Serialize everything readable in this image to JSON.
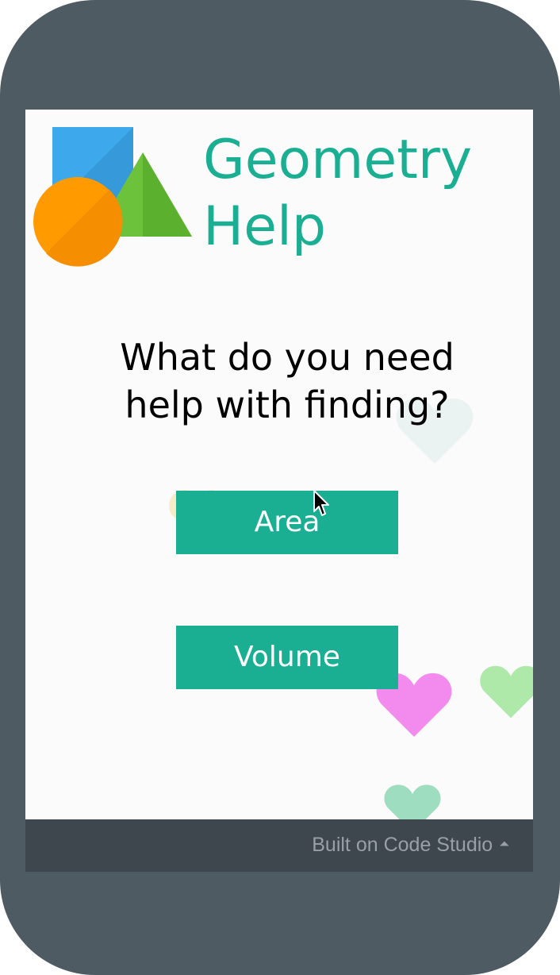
{
  "app": {
    "title_line1": "Geometry",
    "title_line2": "Help"
  },
  "question": {
    "line1": "What do you need",
    "line2": "help with finding?"
  },
  "buttons": {
    "area_label": "Area",
    "volume_label": "Volume"
  },
  "footer": {
    "label": "Built on Code Studio",
    "caret": "⏶"
  },
  "colors": {
    "accent": "#1aaf93",
    "frame": "#4f5b63",
    "screen": "#fbfbfb",
    "footer": "#3e474e",
    "logo_square": "#3ea8ec",
    "logo_triangle": "#6cc23a",
    "logo_circle": "#ff9a00",
    "heart_pink": "#f38bef",
    "heart_green": "#a7e8a1",
    "heart_teal": "#8fd8b6"
  },
  "icons": [
    "geometry-shapes-logo",
    "heart-icon",
    "caret-up-icon",
    "mouse-pointer-icon"
  ]
}
